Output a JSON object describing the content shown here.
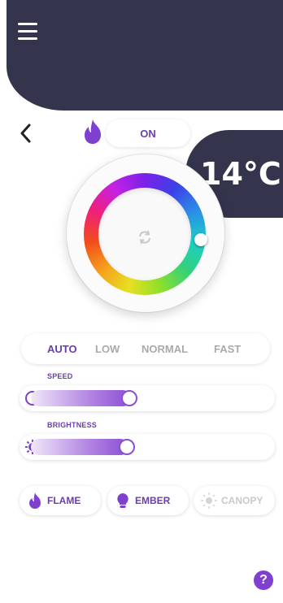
{
  "status": {
    "power_label": "ON"
  },
  "temperature": {
    "value": "14°C"
  },
  "modes": [
    {
      "label": "AUTO",
      "active": true
    },
    {
      "label": "LOW",
      "active": false
    },
    {
      "label": "NORMAL",
      "active": false
    },
    {
      "label": "FAST",
      "active": false
    }
  ],
  "sliders": {
    "speed": {
      "label": "SPEED",
      "level": 0.43
    },
    "brightness": {
      "label": "BRIGHTNESS",
      "level": 0.42
    }
  },
  "effects": [
    {
      "label": "FLAME",
      "icon": "flame-icon",
      "enabled": true
    },
    {
      "label": "EMBER",
      "icon": "bulb-icon",
      "enabled": true
    },
    {
      "label": "CANOPY",
      "icon": "sun-icon",
      "enabled": false
    }
  ],
  "colors": {
    "accent": "#6a3fa8",
    "header": "#34344d",
    "help": "#7f3fcf"
  },
  "help": {
    "symbol": "?"
  }
}
